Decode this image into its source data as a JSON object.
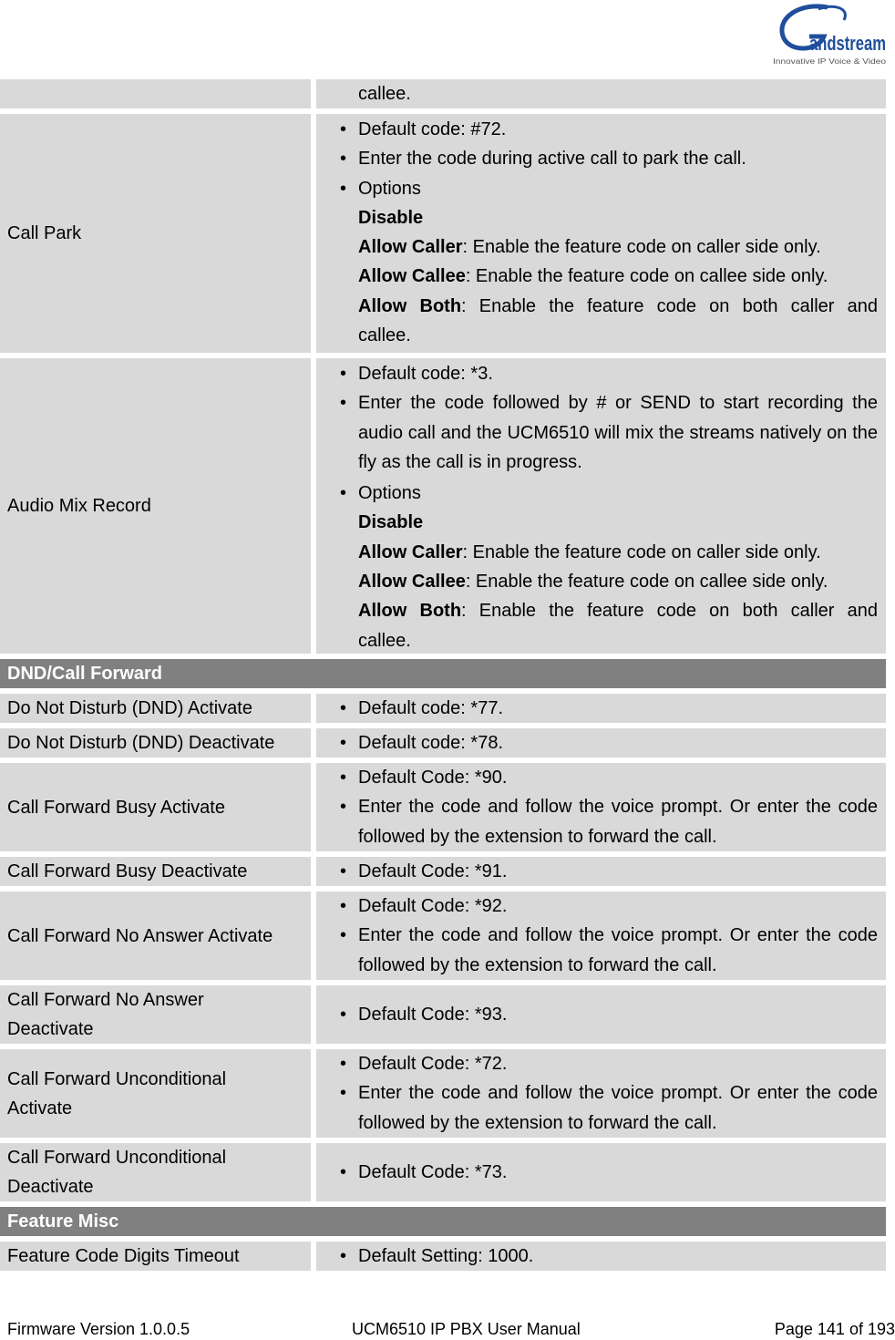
{
  "header": {
    "logo": {
      "brand": "Grandstream",
      "tagline": "Innovative IP Voice & Video",
      "icon": "grandstream-logo-icon"
    }
  },
  "table": {
    "continued_row": {
      "label": "",
      "text": "callee."
    },
    "call_park": {
      "label": "Call Park",
      "bullets": [
        "Default code: #72.",
        "Enter the code during active call to park the call.",
        "Options"
      ],
      "options": [
        {
          "name": "Disable",
          "desc": ""
        },
        {
          "name": "Allow Caller",
          "desc": ": Enable the feature code on caller side only."
        },
        {
          "name": "Allow Callee",
          "desc": ": Enable the feature code on callee side only."
        },
        {
          "name": "Allow Both",
          "desc": ": Enable the feature code on both caller and",
          "cont": "callee."
        }
      ]
    },
    "audio_mix": {
      "label": "Audio Mix Record",
      "bullets": [
        "Default code: *3.",
        "Enter the code followed by # or SEND to start recording the audio call and the UCM6510 will mix the streams natively on the fly as the call is in progress.",
        "Options"
      ],
      "options": [
        {
          "name": "Disable",
          "desc": ""
        },
        {
          "name": "Allow Caller",
          "desc": ": Enable the feature code on caller side only."
        },
        {
          "name": "Allow Callee",
          "desc": ": Enable the feature code on callee side only."
        },
        {
          "name": "Allow Both",
          "desc": ": Enable the feature code on both caller and",
          "cont": "callee."
        }
      ]
    },
    "section_dnd": "DND/Call Forward",
    "dnd_rows": [
      {
        "label": "Do Not Disturb (DND) Activate",
        "bullets": [
          "Default code: *77."
        ]
      },
      {
        "label": "Do Not Disturb (DND) Deactivate",
        "bullets": [
          "Default code: *78."
        ]
      },
      {
        "label": "Call Forward Busy Activate",
        "bullets": [
          "Default Code: *90.",
          "Enter the code and follow the voice prompt. Or enter the code followed by the extension to forward the call."
        ]
      },
      {
        "label": "Call Forward Busy Deactivate",
        "bullets": [
          "Default Code: *91."
        ]
      },
      {
        "label": "Call Forward No Answer Activate",
        "bullets": [
          "Default Code: *92.",
          "Enter the code and follow the voice prompt. Or enter the code followed by the extension to forward the call."
        ]
      },
      {
        "label": "Call Forward No Answer Deactivate",
        "bullets": [
          "Default Code: *93."
        ]
      },
      {
        "label": "Call Forward Unconditional Activate",
        "bullets": [
          "Default Code: *72.",
          "Enter the code and follow the voice prompt. Or enter the code followed by the extension to forward the call."
        ]
      },
      {
        "label": "Call Forward Unconditional Deactivate",
        "bullets": [
          "Default Code: *73."
        ]
      }
    ],
    "section_misc": "Feature Misc",
    "misc_rows": [
      {
        "label": "Feature Code Digits Timeout",
        "bullets": [
          "Default Setting: 1000."
        ]
      }
    ]
  },
  "footer": {
    "firmware": "Firmware Version 1.0.0.5",
    "manual": "UCM6510 IP PBX User Manual",
    "page": "Page 141 of 193"
  }
}
